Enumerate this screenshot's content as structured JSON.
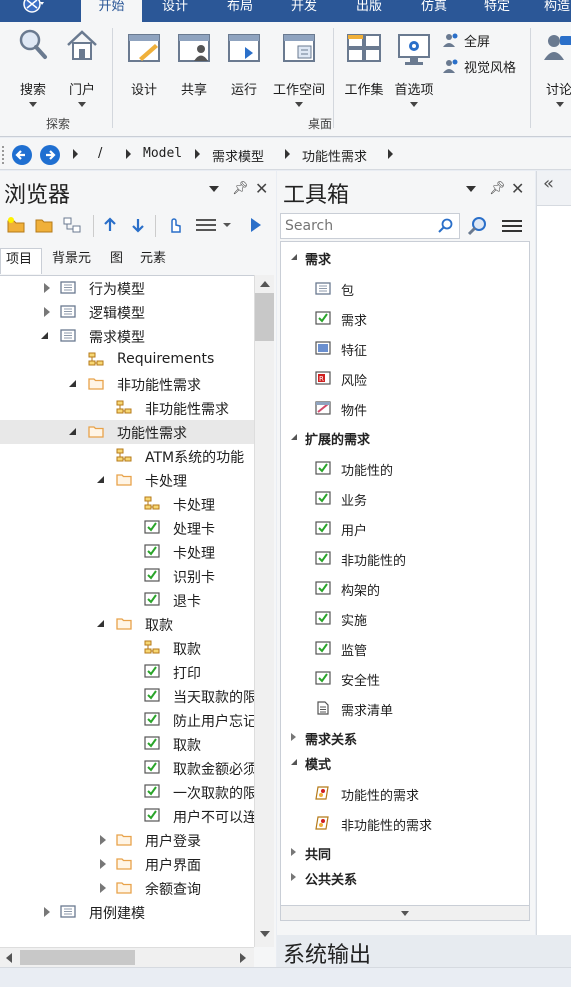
{
  "ribbon_tabs": [
    {
      "label": "开始",
      "active": true
    },
    {
      "label": "设计",
      "active": false
    },
    {
      "label": "布局",
      "active": false
    },
    {
      "label": "开发",
      "active": false
    },
    {
      "label": "出版",
      "active": false
    },
    {
      "label": "仿真",
      "active": false
    },
    {
      "label": "特定",
      "active": false
    },
    {
      "label": "构造",
      "active": false
    }
  ],
  "ribbon": {
    "search": "搜索",
    "portal": "门户",
    "explore_group": "探索",
    "design": "设计",
    "share": "共享",
    "run": "运行",
    "workspace": "工作空间",
    "worksets": "工作集",
    "preferences": "首选项",
    "fullscreen": "全屏",
    "visual_style": "视觉风格",
    "desktop_group": "桌面",
    "discuss": "讨论"
  },
  "breadcrumb": [
    "/",
    "Model",
    "需求模型",
    "功能性需求"
  ],
  "browser": {
    "title": "浏览器",
    "tabs": [
      "项目",
      "背景元",
      "图",
      "元素"
    ],
    "tree": [
      {
        "label": "行为模型",
        "icon": "package",
        "level": 0,
        "toggle": "closed"
      },
      {
        "label": "逻辑模型",
        "icon": "package",
        "level": 0,
        "toggle": "closed"
      },
      {
        "label": "需求模型",
        "icon": "package",
        "level": 0,
        "toggle": "open"
      },
      {
        "label": "Requirements",
        "icon": "diagram",
        "level": 1,
        "toggle": "none"
      },
      {
        "label": "非功能性需求",
        "icon": "folder",
        "level": 1,
        "toggle": "open"
      },
      {
        "label": "非功能性需求",
        "icon": "diagram",
        "level": 2,
        "toggle": "none"
      },
      {
        "label": "功能性需求",
        "icon": "folder",
        "level": 1,
        "toggle": "open",
        "selected": true
      },
      {
        "label": "ATM系统的功能",
        "icon": "diagram",
        "level": 2,
        "toggle": "none"
      },
      {
        "label": "卡处理",
        "icon": "folder",
        "level": 2,
        "toggle": "open"
      },
      {
        "label": "卡处理",
        "icon": "diagram",
        "level": 3,
        "toggle": "none"
      },
      {
        "label": "处理卡",
        "icon": "req",
        "level": 3,
        "toggle": "none"
      },
      {
        "label": "卡处理",
        "icon": "req",
        "level": 3,
        "toggle": "none"
      },
      {
        "label": "识别卡",
        "icon": "req",
        "level": 3,
        "toggle": "none"
      },
      {
        "label": "退卡",
        "icon": "req",
        "level": 3,
        "toggle": "none"
      },
      {
        "label": "取款",
        "icon": "folder",
        "level": 2,
        "toggle": "open"
      },
      {
        "label": "取款",
        "icon": "diagram",
        "level": 3,
        "toggle": "none"
      },
      {
        "label": "打印",
        "icon": "req",
        "level": 3,
        "toggle": "none"
      },
      {
        "label": "当天取款的限",
        "icon": "req",
        "level": 3,
        "toggle": "none"
      },
      {
        "label": "防止用户忘记",
        "icon": "req",
        "level": 3,
        "toggle": "none"
      },
      {
        "label": "取款",
        "icon": "req",
        "level": 3,
        "toggle": "none"
      },
      {
        "label": "取款金额必须",
        "icon": "req",
        "level": 3,
        "toggle": "none"
      },
      {
        "label": "一次取款的限",
        "icon": "req",
        "level": 3,
        "toggle": "none"
      },
      {
        "label": "用户不可以连",
        "icon": "req",
        "level": 3,
        "toggle": "none"
      },
      {
        "label": "用户登录",
        "icon": "folder",
        "level": 2,
        "toggle": "closed"
      },
      {
        "label": "用户界面",
        "icon": "folder",
        "level": 2,
        "toggle": "closed"
      },
      {
        "label": "余额查询",
        "icon": "folder",
        "level": 2,
        "toggle": "closed"
      },
      {
        "label": "用例建模",
        "icon": "package",
        "level": 0,
        "toggle": "closed"
      }
    ]
  },
  "toolbox": {
    "title": "工具箱",
    "search_placeholder": "Search",
    "sections": [
      {
        "label": "需求",
        "expanded": true,
        "items": [
          {
            "label": "包",
            "icon": "package"
          },
          {
            "label": "需求",
            "icon": "req"
          },
          {
            "label": "特征",
            "icon": "feature"
          },
          {
            "label": "风险",
            "icon": "risk"
          },
          {
            "label": "物件",
            "icon": "artifact"
          }
        ]
      },
      {
        "label": "扩展的需求",
        "expanded": true,
        "items": [
          {
            "label": "功能性的",
            "icon": "req"
          },
          {
            "label": "业务",
            "icon": "req"
          },
          {
            "label": "用户",
            "icon": "req"
          },
          {
            "label": "非功能性的",
            "icon": "req"
          },
          {
            "label": "构架的",
            "icon": "req"
          },
          {
            "label": "实施",
            "icon": "req"
          },
          {
            "label": "监管",
            "icon": "req"
          },
          {
            "label": "安全性",
            "icon": "req"
          },
          {
            "label": "需求清单",
            "icon": "doc"
          }
        ]
      },
      {
        "label": "需求关系",
        "expanded": false,
        "items": []
      },
      {
        "label": "模式",
        "expanded": true,
        "items": [
          {
            "label": "功能性的需求",
            "icon": "pattern"
          },
          {
            "label": "非功能性的需求",
            "icon": "pattern"
          }
        ]
      },
      {
        "label": "共同",
        "expanded": false,
        "items": []
      },
      {
        "label": "公共关系",
        "expanded": false,
        "items": []
      }
    ]
  },
  "system_output": {
    "title": "系统输出"
  },
  "colors": {
    "accent": "#2b5797",
    "nav_blue": "#1f6fd1",
    "req_green": "#2aa52a",
    "folder_orange": "#e8a24a"
  }
}
